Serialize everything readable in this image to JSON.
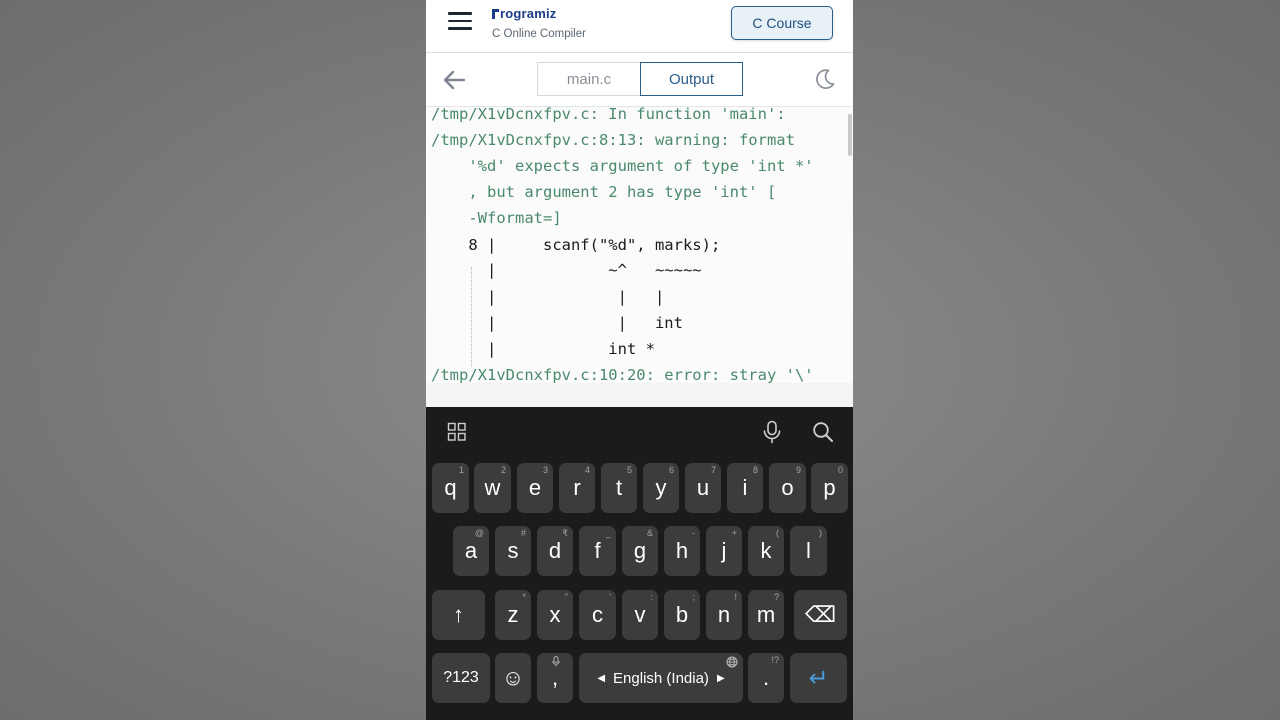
{
  "header": {
    "brand": "rogramiz",
    "subtitle": "C Online Compiler",
    "course_button": "C Course"
  },
  "tabs": {
    "main": "main.c",
    "output": "Output"
  },
  "output_lines": [
    "/tmp/X1vDcnxfpv.c: In function 'main':",
    "/tmp/X1vDcnxfpv.c:8:13: warning: format",
    "    '%d' expects argument of type 'int *'",
    "    , but argument 2 has type 'int' [",
    "    -Wformat=]",
    "    8 |     scanf(\"%d\", marks);",
    "      |            ~^   ~~~~~",
    "      |             |   |",
    "      |             |   int",
    "      |            int *",
    "/tmp/X1vDcnxfpv.c:10:20: error: stray '\\'"
  ],
  "keyboard": {
    "row1": [
      {
        "key": "q",
        "hint": "1"
      },
      {
        "key": "w",
        "hint": "2"
      },
      {
        "key": "e",
        "hint": "3"
      },
      {
        "key": "r",
        "hint": "4"
      },
      {
        "key": "t",
        "hint": "5"
      },
      {
        "key": "y",
        "hint": "6"
      },
      {
        "key": "u",
        "hint": "7"
      },
      {
        "key": "i",
        "hint": "8"
      },
      {
        "key": "o",
        "hint": "9"
      },
      {
        "key": "p",
        "hint": "0"
      }
    ],
    "row2": [
      {
        "key": "a",
        "hint": "@"
      },
      {
        "key": "s",
        "hint": "#"
      },
      {
        "key": "d",
        "hint": "₹"
      },
      {
        "key": "f",
        "hint": "_"
      },
      {
        "key": "g",
        "hint": "&"
      },
      {
        "key": "h",
        "hint": "-"
      },
      {
        "key": "j",
        "hint": "+"
      },
      {
        "key": "k",
        "hint": "("
      },
      {
        "key": "l",
        "hint": ")"
      }
    ],
    "row3": [
      {
        "key": "z",
        "hint": "*"
      },
      {
        "key": "x",
        "hint": "\""
      },
      {
        "key": "c",
        "hint": "'"
      },
      {
        "key": "v",
        "hint": ":"
      },
      {
        "key": "b",
        "hint": ";"
      },
      {
        "key": "n",
        "hint": "!"
      },
      {
        "key": "m",
        "hint": "?"
      }
    ],
    "num_key": "?123",
    "comma": ",",
    "space_label": "English (India)",
    "period": ".",
    "period_hint": "!?",
    "shift_glyph": "↑",
    "backspace_glyph": "⌫",
    "enter_glyph": "↵",
    "emoji_glyph": "☺"
  },
  "colors": {
    "brand": "#1b3c87",
    "accent": "#2b5d8b",
    "console_message": "#4a8a6b",
    "enter_key": "#4a9ad6"
  }
}
